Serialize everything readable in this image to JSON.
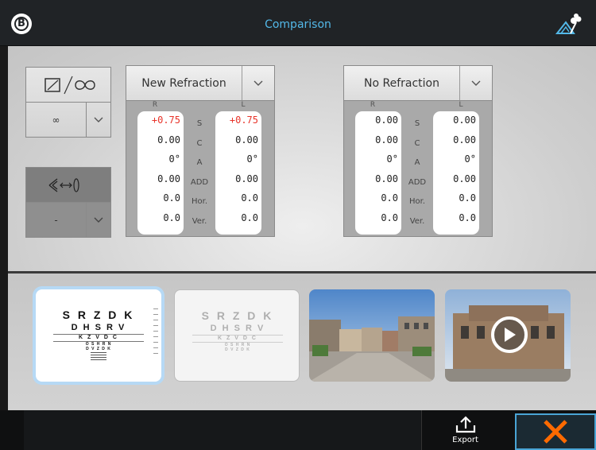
{
  "header": {
    "title": "Comparison",
    "logo_icon": "b-logo-icon",
    "right_icon": "mountain-flower-icon",
    "accent": "#53b8e8"
  },
  "left_controls": {
    "box1": {
      "icon": "monitor-infinity-icon",
      "value": "∞"
    },
    "box2": {
      "icon": "eye-distance-icon",
      "value": "-"
    }
  },
  "refraction_left": {
    "name": "New Refraction",
    "col_r": "R",
    "col_l": "L",
    "labels": [
      "S",
      "C",
      "A",
      "ADD",
      "Hor.",
      "Ver."
    ],
    "r": [
      "+0.75",
      "0.00",
      "0°",
      "0.00",
      "0.0",
      "0.0"
    ],
    "l": [
      "+0.75",
      "0.00",
      "0°",
      "0.00",
      "0.0",
      "0.0"
    ]
  },
  "refraction_right": {
    "name": "No Refraction",
    "col_r": "R",
    "col_l": "L",
    "labels": [
      "S",
      "C",
      "A",
      "ADD",
      "Hor.",
      "Ver."
    ],
    "r": [
      "0.00",
      "0.00",
      "0°",
      "0.00",
      "0.0",
      "0.0"
    ],
    "l": [
      "0.00",
      "0.00",
      "0°",
      "0.00",
      "0.0",
      "0.0"
    ]
  },
  "thumbnails": {
    "chart_lines": [
      "S R Z D K",
      "D H S R V",
      "K Z V D C",
      "O S H R N",
      "D V Z D K"
    ],
    "items": [
      "acuity-chart-selected",
      "acuity-chart-faded",
      "street-photo",
      "building-video"
    ]
  },
  "footer": {
    "export_label": "Export",
    "close_icon": "close-x-icon",
    "close_color": "#ff6a00"
  }
}
